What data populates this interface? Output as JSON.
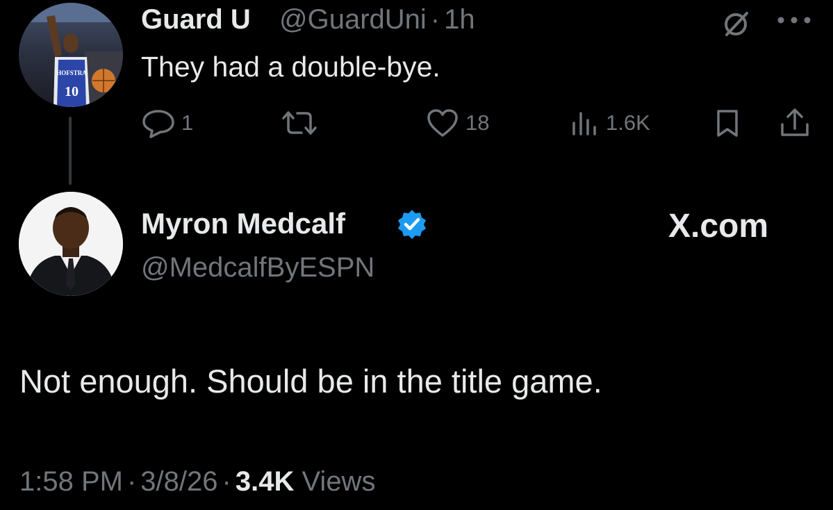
{
  "parent_tweet": {
    "display_name": "Guard U",
    "handle": "@GuardUni",
    "separator": "·",
    "time": "1h",
    "text": "They had a double-bye.",
    "avatar_jersey_text": "HOFSTRA",
    "avatar_jersey_number": "10",
    "actions": {
      "reply_count": "1",
      "repost_count": "",
      "like_count": "18",
      "view_count": "1.6K"
    }
  },
  "reply_tweet": {
    "display_name": "Myron Medcalf",
    "handle": "@MedcalfByESPN",
    "site_label": "X.com",
    "text": "Not enough. Should be in the title game.",
    "time": "1:58 PM",
    "date": "3/8/26",
    "separator": "·",
    "views_count": "3.4K",
    "views_label": "Views"
  },
  "colors": {
    "background": "#000000",
    "text_primary": "#e7e9ea",
    "text_secondary": "#71767b",
    "verified_blue": "#1d9bf0",
    "thread_line": "#333639"
  }
}
